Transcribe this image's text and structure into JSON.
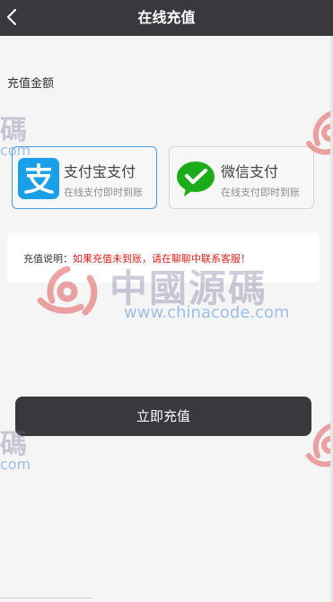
{
  "header": {
    "title": "在线充值",
    "back_icon": "chevron-left-icon"
  },
  "form": {
    "amount_label": "充值金额"
  },
  "payment_methods": [
    {
      "name": "支付宝支付",
      "subtitle": "在线支付即时到账",
      "icon": "alipay-icon",
      "selected": true,
      "color": "#1aa0e8"
    },
    {
      "name": "微信支付",
      "subtitle": "在线支付即时到账",
      "icon": "wechat-pay-icon",
      "selected": false,
      "color": "#1aad19"
    }
  ],
  "notice": {
    "label": "充值说明：",
    "text": "如果充值未到账，请在聊聊中联系客服！",
    "warn_color": "#e0201a"
  },
  "actions": {
    "submit_label": "立即充值"
  },
  "watermark": {
    "brand_text": "中國源碼",
    "url_text": "www.chinacode.com",
    "partial_text": "碼",
    "partial_url": "com"
  },
  "colors": {
    "header_bg": "#3b383d",
    "button_bg": "#3b383d",
    "selected_border": "#4a9fe3"
  }
}
